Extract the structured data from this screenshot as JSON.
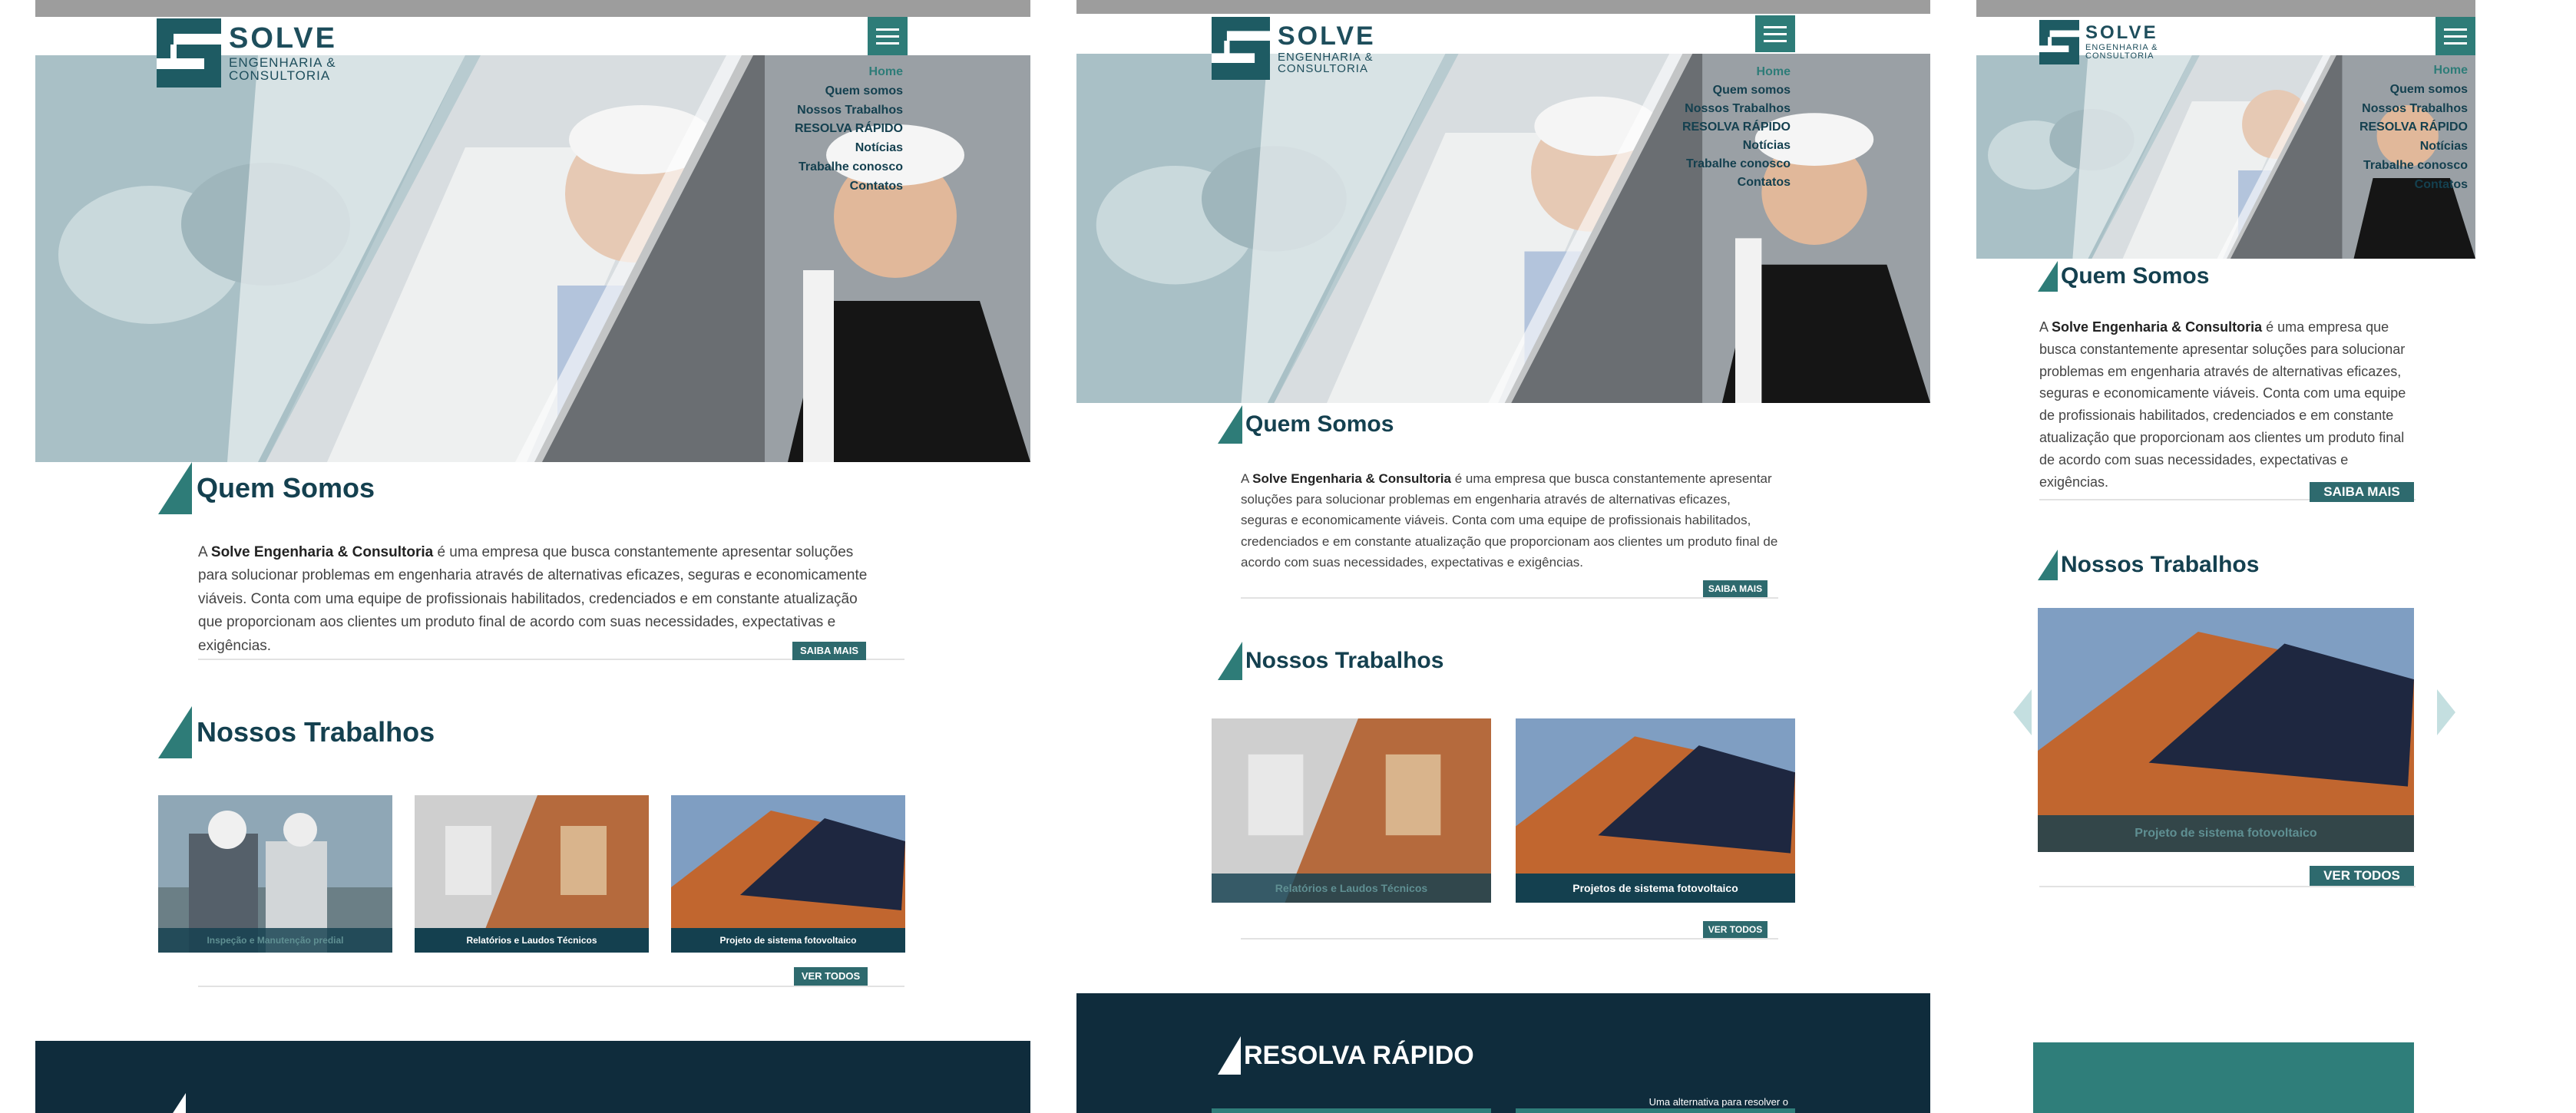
{
  "brand": {
    "name": "SOLVE",
    "sub_line1": "ENGENHARIA &",
    "sub_line2": "CONSULTORIA"
  },
  "nav": {
    "items": [
      "Home",
      "Quem somos",
      "Nossos Trabalhos",
      "RESOLVA RÁPIDO",
      "Notícias",
      "Trabalhe conosco",
      "Contatos"
    ]
  },
  "about": {
    "title": "Quem Somos",
    "company": "Solve Engenharia & Consultoria",
    "text": " é uma empresa que busca constantemente apresentar soluções para solucionar problemas em engenharia através de alternativas eficazes, seguras e economicamente viáveis. Conta com uma equipe de profissionais habilitados, credenciados e em constante atualização que proporcionam aos clientes um produto final de acordo com suas necessidades, expectativas e exigências.",
    "article": "A",
    "button": "SAIBA MAIS"
  },
  "works": {
    "title": "Nossos Trabalhos",
    "items": [
      "Inspeção e Manutenção predial",
      "Relatórios e Laudos Técnicos",
      "Projeto de sistema fotovoltaico",
      "Projetos de sistema fotovoltaico"
    ],
    "button": "VER TODOS"
  },
  "quick": {
    "title": "RESOLVA RÁPIDO",
    "teaser": "Uma alternativa para resolver o"
  },
  "colors": {
    "brand": "#1e5b63",
    "accent": "#2e7c78",
    "dark": "#0f2c3c",
    "topbar": "#9d9d9d"
  }
}
